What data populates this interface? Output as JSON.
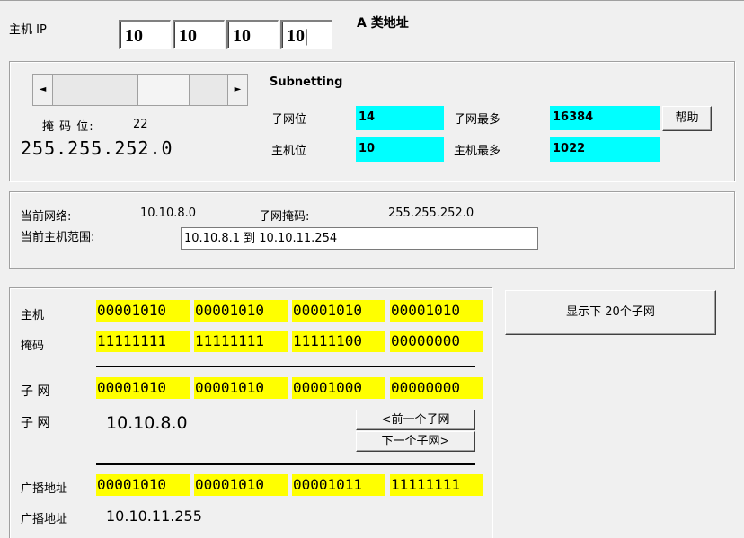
{
  "host_ip": {
    "label": "主机 IP",
    "octets": [
      "10",
      "10",
      "10",
      "10"
    ],
    "class_label": "A 类地址"
  },
  "subnetting": {
    "title": "Subnetting",
    "mask_bits_label": "掩 码 位:",
    "mask_bits_value": "22",
    "mask_bits_fraction": 0.69,
    "mask_dotted": "255.255.252.0",
    "subnet_bits_label": "子网位",
    "subnet_bits_value": "14",
    "max_subnets_label": "子网最多",
    "max_subnets_value": "16384",
    "host_bits_label": "主机位",
    "host_bits_value": "10",
    "max_hosts_label": "主机最多",
    "max_hosts_value": "1022",
    "help_button": "帮助"
  },
  "current": {
    "network_label": "当前网络:",
    "network_value": "10.10.8.0",
    "mask_label": "子网掩码:",
    "mask_value": "255.255.252.0",
    "range_label": "当前主机范围:",
    "range_value": "10.10.8.1 到 10.10.11.254"
  },
  "binary": {
    "host_label": "主机",
    "host_bits": [
      "00001010",
      "00001010",
      "00001010",
      "00001010"
    ],
    "mask_label": "掩码",
    "mask_bits": [
      "11111111",
      "11111111",
      "11111100",
      "00000000"
    ],
    "subnet_label": "子 网",
    "subnet_bits": [
      "00001010",
      "00001010",
      "00001000",
      "00000000"
    ],
    "subnet_addr_label": "子 网",
    "subnet_addr": "10.10.8.0",
    "prev_subnet_button": "<前一个子网",
    "next_subnet_button": "下一个子网>",
    "broadcast_label": "广播地址",
    "broadcast_bits": [
      "00001010",
      "00001010",
      "00001011",
      "11111111"
    ],
    "broadcast_addr_label": "广播地址",
    "broadcast_addr": "10.10.11.255"
  },
  "show_next_button": "显示下 20个子网"
}
